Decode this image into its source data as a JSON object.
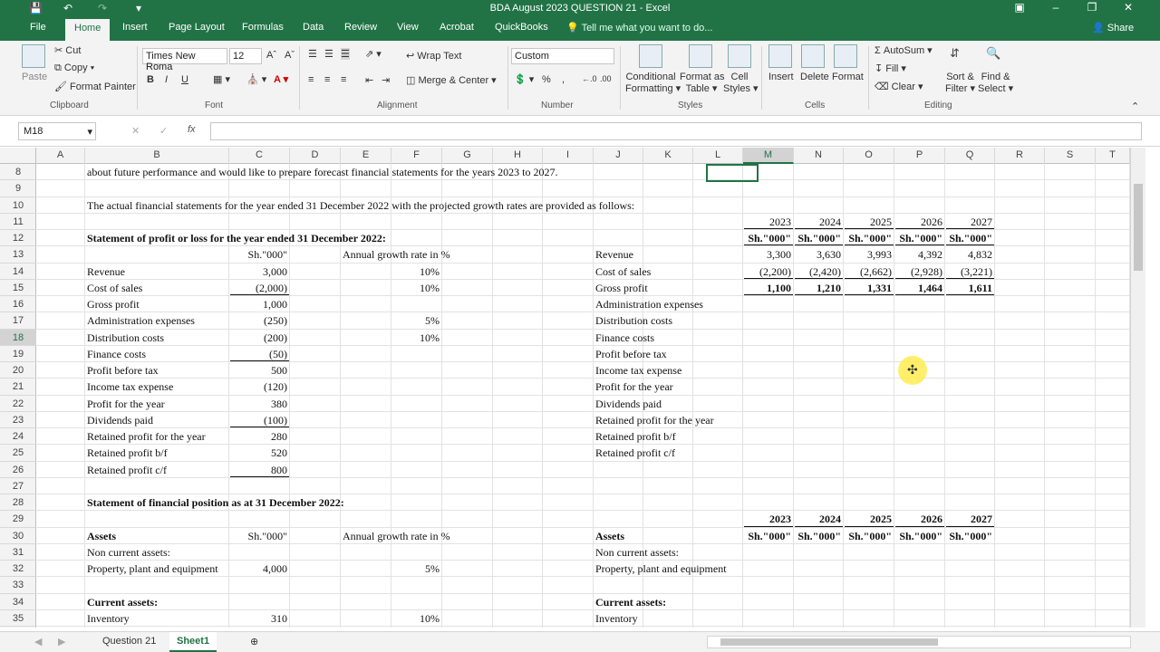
{
  "window": {
    "title": "BDA August 2023 QUESTION 21 - Excel"
  },
  "tabs": [
    "File",
    "Home",
    "Insert",
    "Page Layout",
    "Formulas",
    "Data",
    "Review",
    "View",
    "Acrobat",
    "QuickBooks"
  ],
  "tell_me": "Tell me what you want to do...",
  "share": "Share",
  "ribbon": {
    "clipboard": {
      "paste": "Paste",
      "cut": "Cut",
      "copy": "Copy",
      "format_painter": "Format Painter",
      "group": "Clipboard"
    },
    "font": {
      "name": "Times New Roma",
      "size": "12",
      "group": "Font",
      "bold": "B",
      "italic": "I",
      "underline": "U"
    },
    "alignment": {
      "wrap": "Wrap Text",
      "merge": "Merge & Center",
      "group": "Alignment"
    },
    "number": {
      "format": "Custom",
      "group": "Number",
      "percent": "%",
      "comma": ","
    },
    "styles": {
      "cond1": "Conditional",
      "cond2": "Formatting",
      "fmt1": "Format as",
      "fmt2": "Table",
      "cell1": "Cell",
      "cell2": "Styles",
      "group": "Styles"
    },
    "cells": {
      "insert": "Insert",
      "delete": "Delete",
      "format": "Format",
      "group": "Cells"
    },
    "editing": {
      "autosum": "AutoSum",
      "fill": "Fill",
      "clear": "Clear",
      "sort1": "Sort &",
      "sort2": "Filter",
      "find1": "Find &",
      "find2": "Select",
      "group": "Editing"
    }
  },
  "formula_bar": {
    "name_box": "M18",
    "fx": "fx",
    "value": ""
  },
  "columns": [
    "A",
    "B",
    "C",
    "D",
    "E",
    "F",
    "G",
    "H",
    "I",
    "J",
    "K",
    "L",
    "M",
    "N",
    "O",
    "P",
    "Q",
    "R",
    "S",
    "T"
  ],
  "rows": [
    "8",
    "9",
    "10",
    "11",
    "12",
    "13",
    "14",
    "15",
    "16",
    "17",
    "18",
    "19",
    "20",
    "21",
    "22",
    "23",
    "24",
    "25",
    "26",
    "27",
    "28",
    "29",
    "30",
    "31",
    "32",
    "33",
    "34",
    "35"
  ],
  "cells": {
    "r8": "about future performance and would like to prepare forecast financial statements for the years 2023 to 2027.",
    "r10": "The actual financial statements for the year ended 31 December 2022 with the projected growth rates are provided as follows:",
    "r12": "Statement of profit or loss for the year ended 31 December 2022:",
    "unit": "Sh.\"000\"",
    "growth_hdr": "Annual growth rate in %",
    "pl_labels": [
      "Revenue",
      "Cost of sales",
      "Gross profit",
      "Administration expenses",
      "Distribution costs",
      "Finance costs",
      "Profit before tax",
      "Income tax expense",
      "Profit for the year",
      "Dividends paid",
      "Retained profit for the year",
      "Retained profit b/f",
      "Retained profit c/f"
    ],
    "pl_values": [
      "3,000",
      "(2,000)",
      "1,000",
      "(250)",
      "(200)",
      "(50)",
      "500",
      "(120)",
      "380",
      "(100)",
      "280",
      "520",
      "800"
    ],
    "pl_growth": [
      "10%",
      "10%",
      "",
      "5%",
      "10%",
      "",
      "",
      "",
      "",
      "",
      "",
      "",
      ""
    ],
    "years": [
      "2023",
      "2024",
      "2025",
      "2026",
      "2027"
    ],
    "fc_revenue": [
      "3,300",
      "3,630",
      "3,993",
      "4,392",
      "4,832"
    ],
    "fc_cos": [
      "(2,200)",
      "(2,420)",
      "(2,662)",
      "(2,928)",
      "(3,221)"
    ],
    "fc_gp": [
      "1,100",
      "1,210",
      "1,331",
      "1,464",
      "1,611"
    ],
    "r28": "Statement of financial position as at 31 December 2022:",
    "assets": "Assets",
    "nca": "Non current assets:",
    "ppe": "Property, plant and equipment",
    "ppe_val": "4,000",
    "ppe_growth": "5%",
    "ca": "Current assets:",
    "inventory": "Inventory",
    "inv_val": "310",
    "inv_growth": "10%"
  },
  "sheets": [
    "Question 21",
    "Sheet1"
  ]
}
